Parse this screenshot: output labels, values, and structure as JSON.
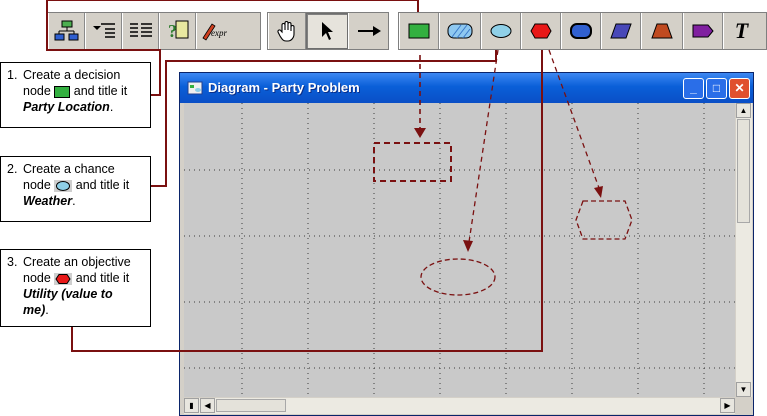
{
  "window": {
    "title": "Diagram - Party Problem",
    "buttons": [
      "minimize",
      "maximize",
      "close"
    ]
  },
  "toolbar": {
    "groups": [
      [
        "org-chart-icon",
        "outline-icon",
        "list-icon",
        "help-icon",
        "expr-icon"
      ],
      [
        "hand-tool-icon",
        "arrow-tool-icon",
        "connector-tool-icon"
      ],
      [
        "decision-node-icon",
        "chance-node-hatched-icon",
        "chance-node-icon",
        "objective-node-icon",
        "module-node-icon",
        "index-node-icon",
        "function-node-icon",
        "alias-node-icon",
        "text-tool-icon"
      ]
    ],
    "expr_label": "expr",
    "text_tool_label": "T"
  },
  "callouts": [
    {
      "number": "1.",
      "text_before": "Create a decision",
      "text_line2": "node",
      "text_after": "and title it",
      "title": "Party Location",
      "end": "."
    },
    {
      "number": "2.",
      "text_before": "Create a chance",
      "text_line2": "node",
      "text_after": "and title it",
      "title": "Weather",
      "end": "."
    },
    {
      "number": "3.",
      "text_before": "Create an objective",
      "text_line2": "node",
      "text_after": "and title it",
      "title_line1": "Utility (value to",
      "title_line2": "me)",
      "end": "."
    }
  ],
  "colors": {
    "decision": "#33b040",
    "chance": "#8fd0e8",
    "objective": "#e81818",
    "connector": "#7a1010",
    "title_bar": "#0a5fd8",
    "canvas": "#c9c9c9"
  }
}
